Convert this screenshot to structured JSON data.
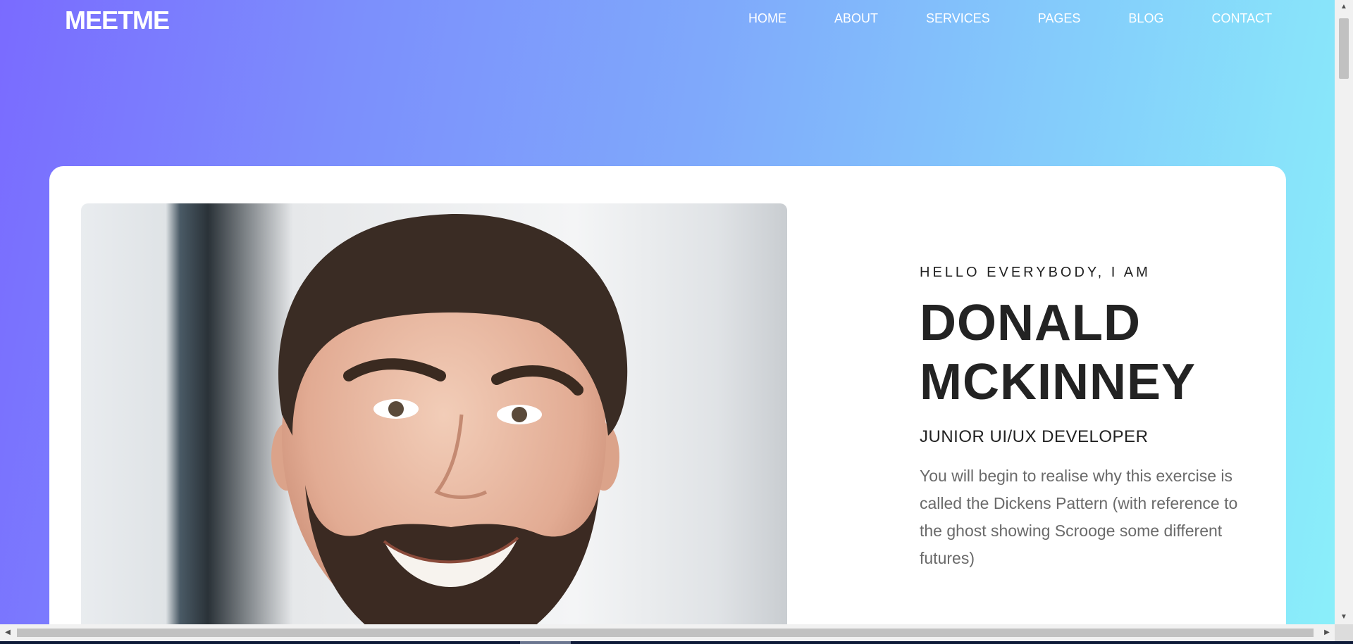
{
  "header": {
    "logo": "MEETME",
    "nav": [
      {
        "label": "HOME"
      },
      {
        "label": "ABOUT"
      },
      {
        "label": "SERVICES"
      },
      {
        "label": "PAGES"
      },
      {
        "label": "BLOG"
      },
      {
        "label": "CONTACT"
      }
    ]
  },
  "hero": {
    "greeting": "HELLO EVERYBODY, I AM",
    "name_line1": "DONALD",
    "name_line2": "MCKINNEY",
    "role": "JUNIOR UI/UX DEVELOPER",
    "description": "You will begin to realise why this exercise is called the Dickens Pattern (with reference to the ghost showing Scrooge some different futures)"
  },
  "colors": {
    "gradient_start": "#7a6bff",
    "gradient_end": "#8aeffa",
    "heading": "#232323",
    "body_text": "#6a6a6a"
  }
}
